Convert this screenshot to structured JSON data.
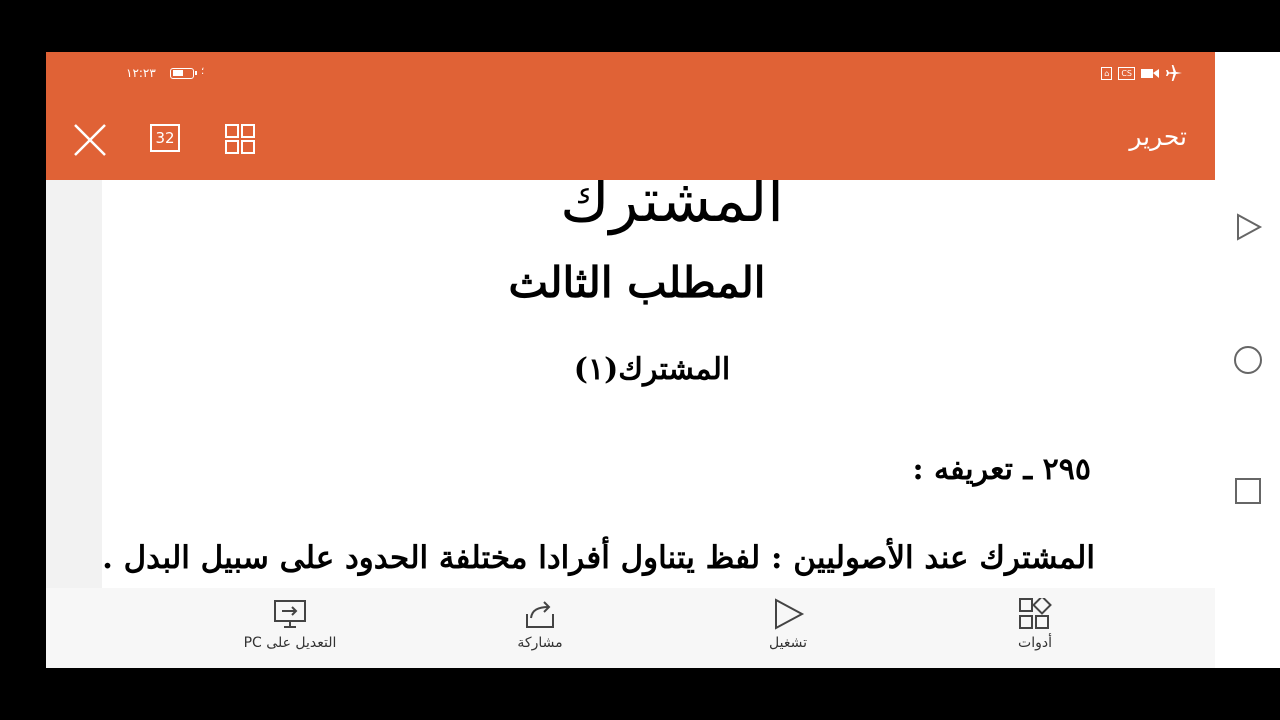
{
  "status_bar": {
    "time": "١٢:٢٣",
    "small_glyph": "؛",
    "cs_label": "CS"
  },
  "header": {
    "page_count": "32",
    "edit_label": "تحرير",
    "background_color": "#e06236"
  },
  "document": {
    "heading_large": "المشترك",
    "heading": "المطلب الثالث",
    "subheading": "المشترك(١)",
    "section_number": "٢٩٥ ـ تعريفه :",
    "definition": "المشترك عند الأصوليين : لفظ يتناول أفرادا مختلفة الحدود على سبيل البدل ."
  },
  "toolbar": {
    "items": [
      {
        "label": "التعديل على PC",
        "icon": "edit-on-pc-icon"
      },
      {
        "label": "مشاركة",
        "icon": "share-icon"
      },
      {
        "label": "تشغيل",
        "icon": "play-icon"
      },
      {
        "label": "أدوات",
        "icon": "tools-icon"
      }
    ]
  },
  "navigation_bar": {
    "buttons": [
      "back-triangle-icon",
      "home-circle-icon",
      "recents-square-icon"
    ]
  }
}
